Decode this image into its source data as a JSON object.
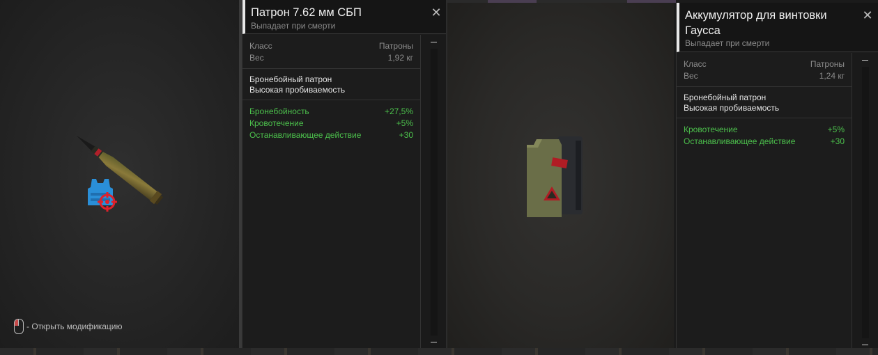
{
  "left_item": {
    "title": "Патрон 7.62 мм СБП",
    "subtitle": "Выпадает при смерти",
    "close_glyph": "✕",
    "props": [
      {
        "key": "Класс",
        "value": "Патроны"
      },
      {
        "key": "Вес",
        "value": "1,92 кг"
      }
    ],
    "description": [
      "Бронебойный патрон",
      "Высокая пробиваемость"
    ],
    "stats": [
      {
        "key": "Бронебойность",
        "value": "+27,5%"
      },
      {
        "key": "Кровотечение",
        "value": "+5%"
      },
      {
        "key": "Останавливающее действие",
        "value": "+30"
      }
    ],
    "hint": "- Открыть модификацию"
  },
  "right_item": {
    "title": "Аккумулятор для винтовки Гаусса",
    "subtitle": "Выпадает при смерти",
    "close_glyph": "✕",
    "props": [
      {
        "key": "Класс",
        "value": "Патроны"
      },
      {
        "key": "Вес",
        "value": "1,24 кг"
      }
    ],
    "description": [
      "Бронебойный патрон",
      "Высокая пробиваемость"
    ],
    "stats": [
      {
        "key": "Кровотечение",
        "value": "+5%"
      },
      {
        "key": "Останавливающее действие",
        "value": "+30"
      }
    ]
  },
  "icons": {
    "bullet": "bullet-icon",
    "armor": "armor-vest-icon",
    "target": "crosshair-icon",
    "battery": "gauss-battery-icon",
    "mouse": "mouse-left-click-icon",
    "close": "close-icon"
  },
  "colors": {
    "stat_positive": "#4cc04c",
    "accent_bar": "#e8e8e8",
    "armor_blue": "#2a8fd8",
    "target_red": "#e0202a"
  }
}
